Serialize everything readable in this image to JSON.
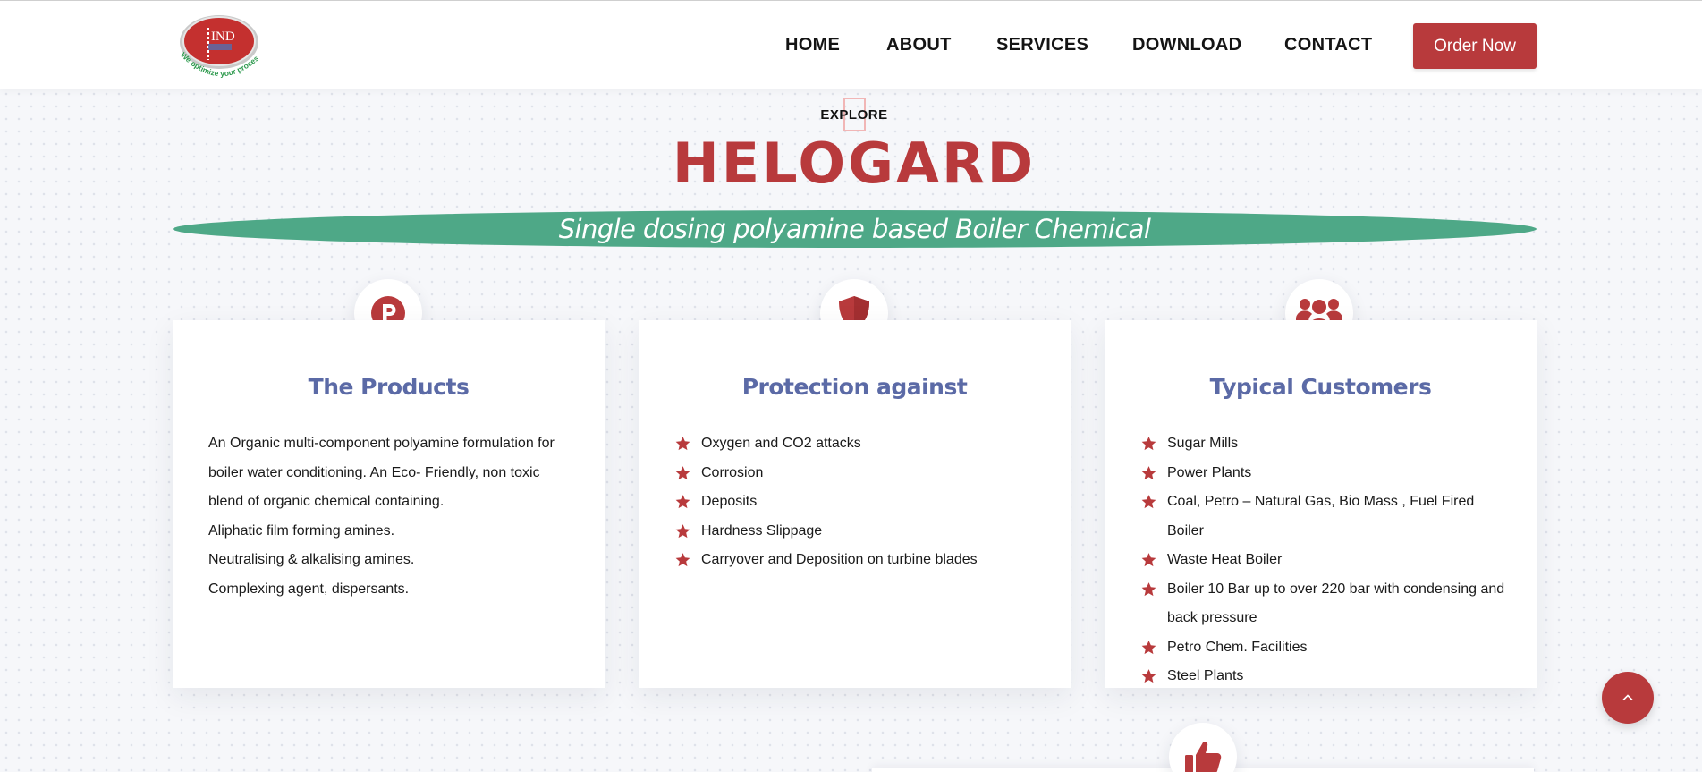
{
  "header": {
    "logo": {
      "text": "IND",
      "tagline": "We optimize your process"
    },
    "nav": [
      {
        "label": "HOME"
      },
      {
        "label": "ABOUT"
      },
      {
        "label": "SERVICES"
      },
      {
        "label": "DOWNLOAD"
      },
      {
        "label": "CONTACT"
      }
    ],
    "order_button": "Order Now"
  },
  "hero": {
    "eyebrow": "EXPLORE",
    "title": "HELOGARD",
    "subtitle": "Single dosing polyamine based Boiler Chemical"
  },
  "cards": [
    {
      "icon": "p-circle-icon",
      "title": "The Products",
      "paragraphs": [
        "An Organic multi-component polyamine formulation for boiler water conditioning. An Eco- Friendly, non toxic blend of organic chemical containing.",
        "Aliphatic film forming amines.",
        "Neutralising & alkalising amines.",
        "Complexing agent, dispersants."
      ]
    },
    {
      "icon": "shield-icon",
      "title": "Protection against",
      "items": [
        "Oxygen and CO2 attacks",
        "Corrosion",
        "Deposits",
        "Hardness Slippage",
        "Carryover and Deposition on turbine blades"
      ]
    },
    {
      "icon": "users-icon",
      "title": "Typical Customers",
      "items": [
        "Sugar Mills",
        "Power Plants",
        "Coal, Petro – Natural Gas, Bio Mass , Fuel Fired Boiler",
        "Waste Heat Boiler",
        "Boiler 10 Bar up to over 220 bar with condensing and back pressure",
        "Petro Chem. Facilities",
        "Steel Plants"
      ]
    }
  ],
  "bottom_icon": "thumbs-up-icon",
  "scroll_top_icon": "chevron-up-icon",
  "colors": {
    "brand_red": "#b83a3c",
    "banner_green": "#4ea887",
    "card_title": "#5b6aa6"
  }
}
